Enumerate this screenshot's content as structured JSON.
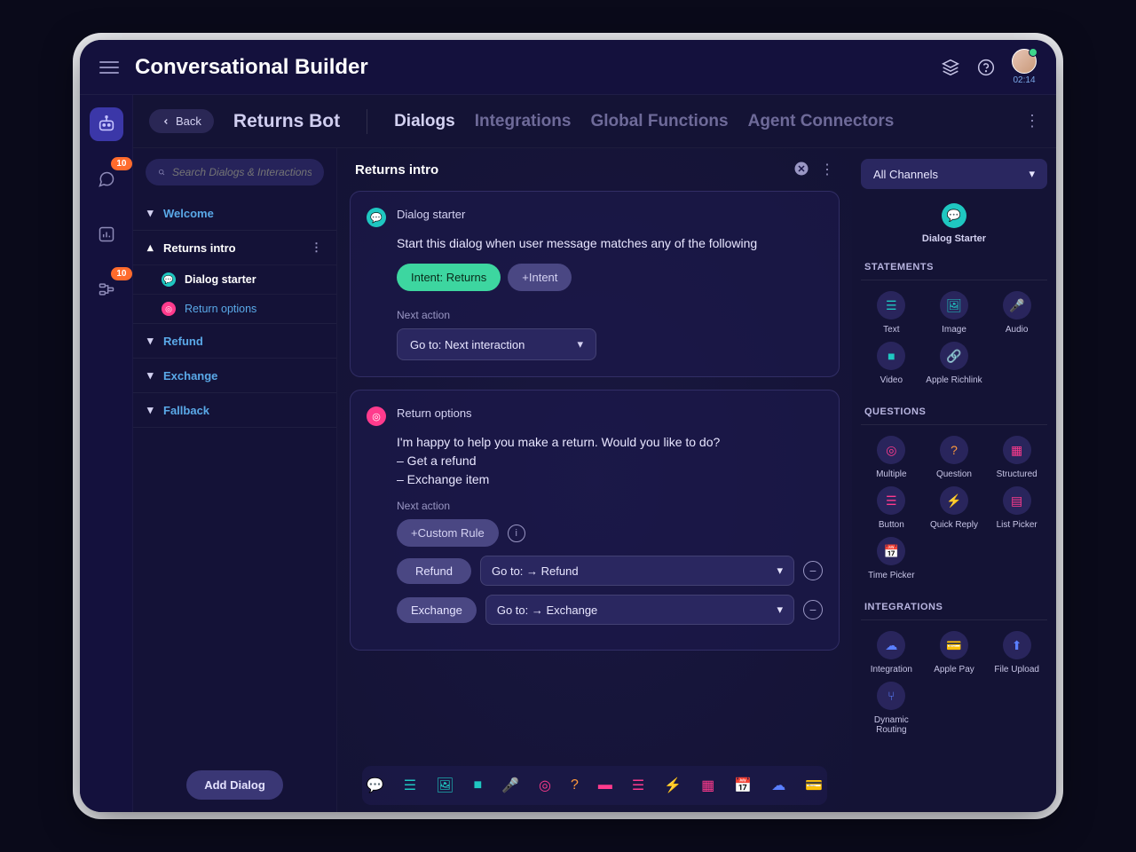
{
  "app_title": "Conversational Builder",
  "timer": "02:14",
  "rail": {
    "chat_badge": "10",
    "flow_badge": "10"
  },
  "tabs": {
    "back": "Back",
    "bot_name": "Returns Bot",
    "items": [
      "Dialogs",
      "Integrations",
      "Global Functions",
      "Agent Connectors"
    ]
  },
  "search_placeholder": "Search Dialogs & Interactions",
  "dialogs": {
    "items": [
      "Welcome",
      "Returns intro",
      "Refund",
      "Exchange",
      "Fallback"
    ],
    "sub": [
      "Dialog starter",
      "Return options"
    ]
  },
  "add_dialog": "Add Dialog",
  "mid": {
    "title": "Returns intro",
    "card1": {
      "title": "Dialog starter",
      "text": "Start this dialog when user message matches any of the following",
      "intent_chip": "Intent: Returns",
      "add_intent": "+Intent",
      "next_action_label": "Next action",
      "next_action_value": "Go to: Next interaction"
    },
    "card2": {
      "title": "Return options",
      "text_l1": "I'm happy to help you make a return. Would you like to do?",
      "text_l2": "– Get a refund",
      "text_l3": "– Exchange item",
      "next_action_label": "Next action",
      "custom_rule": "+Custom Rule",
      "rules": [
        {
          "tag": "Refund",
          "goto": "Go to: → Refund"
        },
        {
          "tag": "Exchange",
          "goto": "Go to: → Exchange"
        }
      ]
    }
  },
  "right": {
    "channel": "All Channels",
    "hero": "Dialog Starter",
    "sections": {
      "statements": {
        "head": "STATEMENTS",
        "items": [
          "Text",
          "Image",
          "Audio",
          "Video",
          "Apple Richlink"
        ]
      },
      "questions": {
        "head": "QUESTIONS",
        "items": [
          "Multiple",
          "Question",
          "Structured",
          "Button",
          "Quick Reply",
          "List Picker",
          "Time Picker"
        ]
      },
      "integrations": {
        "head": "INTEGRATIONS",
        "items": [
          "Integration",
          "Apple Pay",
          "File Upload",
          "Dynamic Routing"
        ]
      }
    }
  }
}
